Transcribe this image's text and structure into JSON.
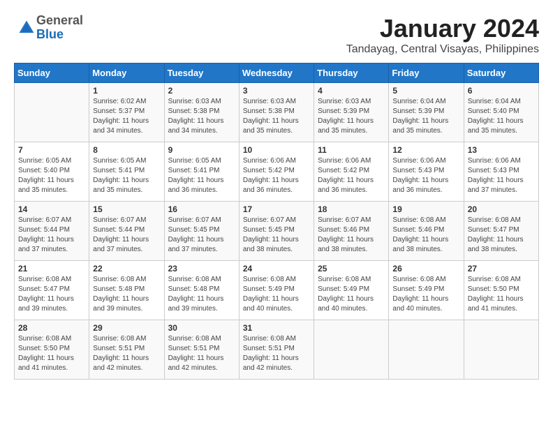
{
  "logo": {
    "general": "General",
    "blue": "Blue"
  },
  "title": "January 2024",
  "location": "Tandayag, Central Visayas, Philippines",
  "days_header": [
    "Sunday",
    "Monday",
    "Tuesday",
    "Wednesday",
    "Thursday",
    "Friday",
    "Saturday"
  ],
  "weeks": [
    [
      {
        "day": "",
        "info": ""
      },
      {
        "day": "1",
        "info": "Sunrise: 6:02 AM\nSunset: 5:37 PM\nDaylight: 11 hours\nand 34 minutes."
      },
      {
        "day": "2",
        "info": "Sunrise: 6:03 AM\nSunset: 5:38 PM\nDaylight: 11 hours\nand 34 minutes."
      },
      {
        "day": "3",
        "info": "Sunrise: 6:03 AM\nSunset: 5:38 PM\nDaylight: 11 hours\nand 35 minutes."
      },
      {
        "day": "4",
        "info": "Sunrise: 6:03 AM\nSunset: 5:39 PM\nDaylight: 11 hours\nand 35 minutes."
      },
      {
        "day": "5",
        "info": "Sunrise: 6:04 AM\nSunset: 5:39 PM\nDaylight: 11 hours\nand 35 minutes."
      },
      {
        "day": "6",
        "info": "Sunrise: 6:04 AM\nSunset: 5:40 PM\nDaylight: 11 hours\nand 35 minutes."
      }
    ],
    [
      {
        "day": "7",
        "info": "Sunrise: 6:05 AM\nSunset: 5:40 PM\nDaylight: 11 hours\nand 35 minutes."
      },
      {
        "day": "8",
        "info": "Sunrise: 6:05 AM\nSunset: 5:41 PM\nDaylight: 11 hours\nand 35 minutes."
      },
      {
        "day": "9",
        "info": "Sunrise: 6:05 AM\nSunset: 5:41 PM\nDaylight: 11 hours\nand 36 minutes."
      },
      {
        "day": "10",
        "info": "Sunrise: 6:06 AM\nSunset: 5:42 PM\nDaylight: 11 hours\nand 36 minutes."
      },
      {
        "day": "11",
        "info": "Sunrise: 6:06 AM\nSunset: 5:42 PM\nDaylight: 11 hours\nand 36 minutes."
      },
      {
        "day": "12",
        "info": "Sunrise: 6:06 AM\nSunset: 5:43 PM\nDaylight: 11 hours\nand 36 minutes."
      },
      {
        "day": "13",
        "info": "Sunrise: 6:06 AM\nSunset: 5:43 PM\nDaylight: 11 hours\nand 37 minutes."
      }
    ],
    [
      {
        "day": "14",
        "info": "Sunrise: 6:07 AM\nSunset: 5:44 PM\nDaylight: 11 hours\nand 37 minutes."
      },
      {
        "day": "15",
        "info": "Sunrise: 6:07 AM\nSunset: 5:44 PM\nDaylight: 11 hours\nand 37 minutes."
      },
      {
        "day": "16",
        "info": "Sunrise: 6:07 AM\nSunset: 5:45 PM\nDaylight: 11 hours\nand 37 minutes."
      },
      {
        "day": "17",
        "info": "Sunrise: 6:07 AM\nSunset: 5:45 PM\nDaylight: 11 hours\nand 38 minutes."
      },
      {
        "day": "18",
        "info": "Sunrise: 6:07 AM\nSunset: 5:46 PM\nDaylight: 11 hours\nand 38 minutes."
      },
      {
        "day": "19",
        "info": "Sunrise: 6:08 AM\nSunset: 5:46 PM\nDaylight: 11 hours\nand 38 minutes."
      },
      {
        "day": "20",
        "info": "Sunrise: 6:08 AM\nSunset: 5:47 PM\nDaylight: 11 hours\nand 38 minutes."
      }
    ],
    [
      {
        "day": "21",
        "info": "Sunrise: 6:08 AM\nSunset: 5:47 PM\nDaylight: 11 hours\nand 39 minutes."
      },
      {
        "day": "22",
        "info": "Sunrise: 6:08 AM\nSunset: 5:48 PM\nDaylight: 11 hours\nand 39 minutes."
      },
      {
        "day": "23",
        "info": "Sunrise: 6:08 AM\nSunset: 5:48 PM\nDaylight: 11 hours\nand 39 minutes."
      },
      {
        "day": "24",
        "info": "Sunrise: 6:08 AM\nSunset: 5:49 PM\nDaylight: 11 hours\nand 40 minutes."
      },
      {
        "day": "25",
        "info": "Sunrise: 6:08 AM\nSunset: 5:49 PM\nDaylight: 11 hours\nand 40 minutes."
      },
      {
        "day": "26",
        "info": "Sunrise: 6:08 AM\nSunset: 5:49 PM\nDaylight: 11 hours\nand 40 minutes."
      },
      {
        "day": "27",
        "info": "Sunrise: 6:08 AM\nSunset: 5:50 PM\nDaylight: 11 hours\nand 41 minutes."
      }
    ],
    [
      {
        "day": "28",
        "info": "Sunrise: 6:08 AM\nSunset: 5:50 PM\nDaylight: 11 hours\nand 41 minutes."
      },
      {
        "day": "29",
        "info": "Sunrise: 6:08 AM\nSunset: 5:51 PM\nDaylight: 11 hours\nand 42 minutes."
      },
      {
        "day": "30",
        "info": "Sunrise: 6:08 AM\nSunset: 5:51 PM\nDaylight: 11 hours\nand 42 minutes."
      },
      {
        "day": "31",
        "info": "Sunrise: 6:08 AM\nSunset: 5:51 PM\nDaylight: 11 hours\nand 42 minutes."
      },
      {
        "day": "",
        "info": ""
      },
      {
        "day": "",
        "info": ""
      },
      {
        "day": "",
        "info": ""
      }
    ]
  ]
}
